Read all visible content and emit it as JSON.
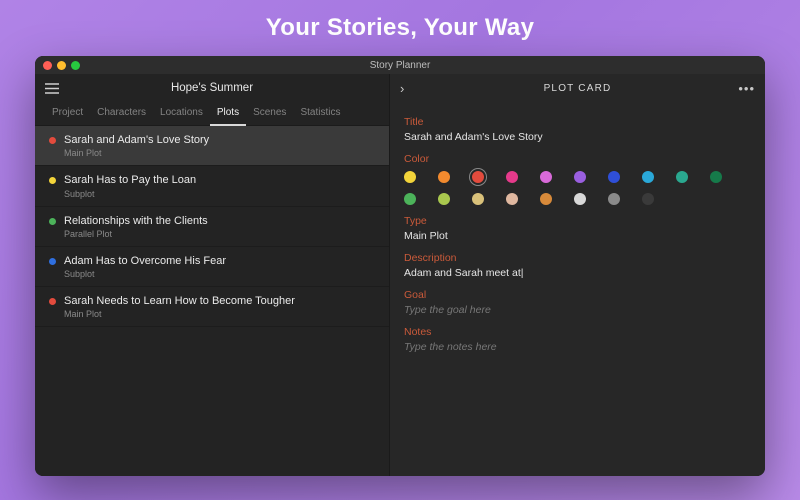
{
  "hero": "Your Stories, Your Way",
  "titlebar": {
    "app_name": "Story Planner"
  },
  "left": {
    "project_title": "Hope's Summer",
    "tabs": [
      "Project",
      "Characters",
      "Locations",
      "Plots",
      "Scenes",
      "Statistics"
    ],
    "active_tab_index": 3,
    "plots": [
      {
        "color": "#e34b3d",
        "title": "Sarah and Adam's Love Story",
        "subtitle": "Main Plot",
        "selected": true
      },
      {
        "color": "#f3d43a",
        "title": "Sarah Has to Pay the Loan",
        "subtitle": "Subplot",
        "selected": false
      },
      {
        "color": "#4cb35a",
        "title": "Relationships with the Clients",
        "subtitle": "Parallel Plot",
        "selected": false
      },
      {
        "color": "#2f6fe0",
        "title": "Adam Has to Overcome His Fear",
        "subtitle": "Subplot",
        "selected": false
      },
      {
        "color": "#e34b3d",
        "title": "Sarah Needs to Learn How to Become Tougher",
        "subtitle": "Main Plot",
        "selected": false
      }
    ]
  },
  "right": {
    "header": "PLOT CARD",
    "labels": {
      "title": "Title",
      "color": "Color",
      "type": "Type",
      "description": "Description",
      "goal": "Goal",
      "notes": "Notes"
    },
    "title_value": "Sarah and Adam's Love Story",
    "type_value": "Main Plot",
    "description_value": "Adam and Sarah meet at",
    "goal_placeholder": "Type the goal here",
    "notes_placeholder": "Type the notes here",
    "colors_row1": [
      "#f3d43a",
      "#f28a2e",
      "#e34b3d",
      "#e63a8b",
      "#d96ad9",
      "#9a5fe0",
      "#2f4fd8",
      "#2aa8d8",
      "#2aa88f",
      "#167a4a"
    ],
    "colors_row2": [
      "#4cb35a",
      "#a9c84e",
      "#d9c17a",
      "#e0b8a0",
      "#d88a3a",
      "#d8d8d8",
      "#8a8a8a",
      "#3a3a3a"
    ],
    "selected_color_index": 2
  }
}
